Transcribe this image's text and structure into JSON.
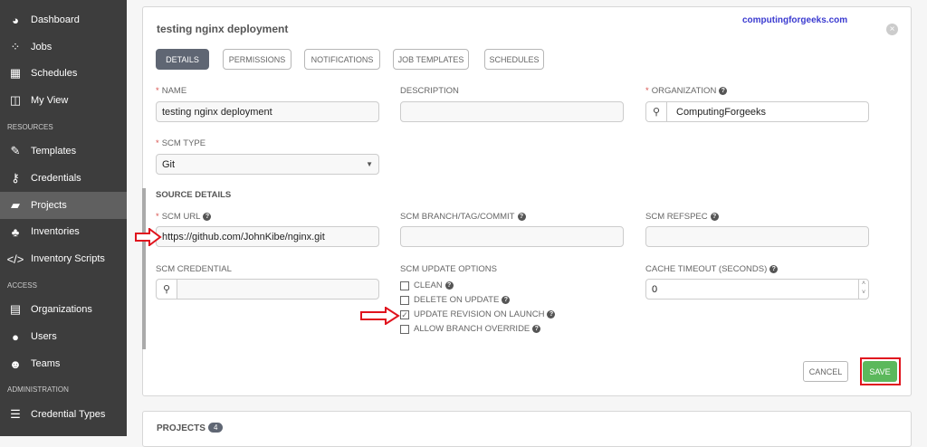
{
  "sidebar": {
    "items": [
      {
        "label": "Dashboard",
        "icon": "dashboard-icon",
        "glyph": "◕"
      },
      {
        "label": "Jobs",
        "icon": "spinner-icon",
        "glyph": "⁘"
      },
      {
        "label": "Schedules",
        "icon": "calendar-icon",
        "glyph": "▦"
      },
      {
        "label": "My View",
        "icon": "columns-icon",
        "glyph": "◫"
      },
      {
        "label": "Templates",
        "icon": "edit-icon",
        "glyph": "✎"
      },
      {
        "label": "Credentials",
        "icon": "key-icon",
        "glyph": "⚷"
      },
      {
        "label": "Projects",
        "icon": "folder-open-icon",
        "glyph": "▰"
      },
      {
        "label": "Inventories",
        "icon": "sitemap-icon",
        "glyph": "♣"
      },
      {
        "label": "Inventory Scripts",
        "icon": "code-icon",
        "glyph": "</>"
      },
      {
        "label": "Organizations",
        "icon": "building-icon",
        "glyph": "▤"
      },
      {
        "label": "Users",
        "icon": "user-icon",
        "glyph": "●"
      },
      {
        "label": "Teams",
        "icon": "users-icon",
        "glyph": "☻"
      },
      {
        "label": "Credential Types",
        "icon": "list-alt-icon",
        "glyph": "☰"
      }
    ],
    "sections": [
      "RESOURCES",
      "ACCESS",
      "ADMINISTRATION"
    ]
  },
  "form": {
    "title": "testing nginx deployment",
    "watermark": "computingforgeeks.com",
    "tabs": [
      "DETAILS",
      "PERMISSIONS",
      "NOTIFICATIONS",
      "JOB TEMPLATES",
      "SCHEDULES"
    ],
    "name_label": "NAME",
    "name_value": "testing nginx deployment",
    "description_label": "DESCRIPTION",
    "description_value": "",
    "organization_label": "ORGANIZATION",
    "organization_value": "ComputingForgeeks",
    "scm_type_label": "SCM TYPE",
    "scm_type_value": "Git",
    "source_details": "SOURCE DETAILS",
    "scm_url_label": "SCM URL",
    "scm_url_value": "https://github.com/JohnKibe/nginx.git",
    "scm_branch_label": "SCM BRANCH/TAG/COMMIT",
    "scm_refspec_label": "SCM REFSPEC",
    "scm_credential_label": "SCM CREDENTIAL",
    "scm_update_label": "SCM UPDATE OPTIONS",
    "options": [
      {
        "label": "CLEAN",
        "checked": false
      },
      {
        "label": "DELETE ON UPDATE",
        "checked": false
      },
      {
        "label": "UPDATE REVISION ON LAUNCH",
        "checked": true
      },
      {
        "label": "ALLOW BRANCH OVERRIDE",
        "checked": false
      }
    ],
    "cache_label": "CACHE TIMEOUT (SECONDS)",
    "cache_value": "0",
    "cancel": "CANCEL",
    "save": "SAVE"
  },
  "projects": {
    "label": "PROJECTS",
    "count": "4"
  },
  "colors": {
    "sidebar": "#3d3d3d",
    "save": "#5cb85c",
    "highlight": "#e0141e",
    "tab_active": "#5f6673"
  }
}
